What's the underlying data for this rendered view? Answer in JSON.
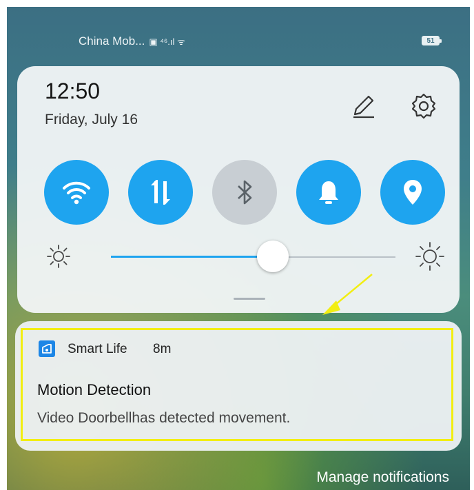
{
  "status_bar": {
    "carrier": "China Mob...",
    "signal_symbols": "▣ ⁴⁶.ıl ᯤ",
    "battery": "51"
  },
  "quick_settings": {
    "time": "12:50",
    "date": "Friday, July 16",
    "toggles": [
      {
        "name": "wifi",
        "state": "on"
      },
      {
        "name": "mobile-data",
        "state": "on"
      },
      {
        "name": "bluetooth",
        "state": "off"
      },
      {
        "name": "sound",
        "state": "on"
      },
      {
        "name": "location",
        "state": "on"
      }
    ],
    "brightness_fraction": 0.57,
    "accent_color": "#1ea4ef"
  },
  "notification": {
    "app_name": "Smart Life",
    "age": "8m",
    "title": "Motion Detection",
    "body": "Video Doorbellhas detected movement.",
    "highlight_color": "#f2ee12"
  },
  "footer": {
    "manage_label": "Manage notifications"
  }
}
